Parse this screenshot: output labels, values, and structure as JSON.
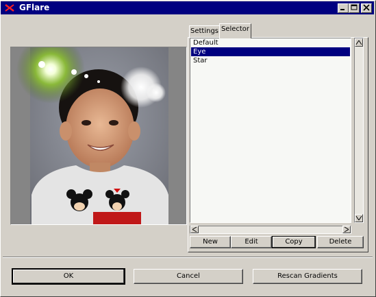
{
  "window": {
    "title": "GFlare"
  },
  "titlebar": {
    "minimize": "_",
    "maximize": "□",
    "close": "✕"
  },
  "tabs": [
    {
      "label": "Settings",
      "active": false
    },
    {
      "label": "Selector",
      "active": true
    }
  ],
  "selector": {
    "items": [
      {
        "label": "Default",
        "selected": false
      },
      {
        "label": "Eye",
        "selected": true
      },
      {
        "label": "Star",
        "selected": false
      }
    ],
    "buttons": {
      "new": "New",
      "edit": "Edit",
      "copy": "Copy",
      "delete": "Delete"
    }
  },
  "dialog_buttons": {
    "ok": "OK",
    "cancel": "Cancel",
    "rescan": "Rescan Gradients"
  },
  "colors": {
    "accent": "#000080",
    "face": "#d4d0c8",
    "list_bg": "#f7f8f5"
  }
}
